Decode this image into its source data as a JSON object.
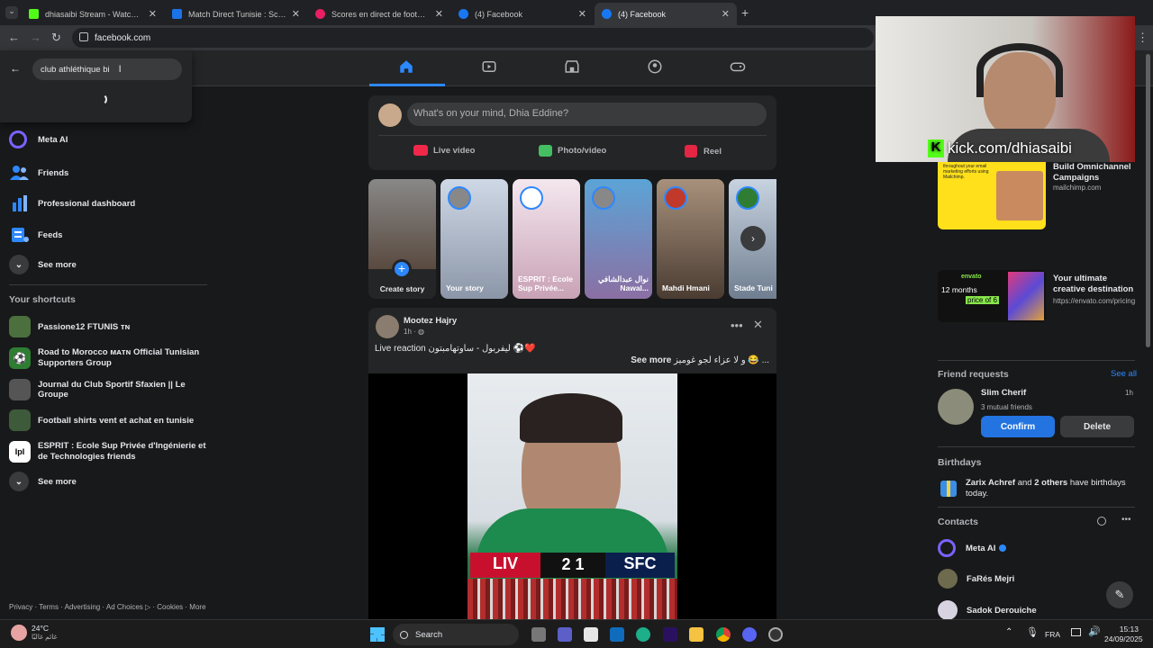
{
  "browser": {
    "tabs": [
      {
        "title": "dhiasaibi Stream - Watch Live o",
        "color": "#53fc18"
      },
      {
        "title": "Match Direct Tunisie : Scores et",
        "color": "#1a73e8"
      },
      {
        "title": "Scores en direct de football, rés",
        "color": "#e91e63"
      },
      {
        "title": "(4) Facebook",
        "color": "#1877f2"
      },
      {
        "title": "(4) Facebook",
        "color": "#1877f2"
      }
    ],
    "url": "facebook.com"
  },
  "search": {
    "value": "club athléthique bi"
  },
  "menu": {
    "items": [
      {
        "label": "Meta AI",
        "icon": "meta-ai-icon"
      },
      {
        "label": "Friends",
        "icon": "friends-icon"
      },
      {
        "label": "Professional dashboard",
        "icon": "dashboard-icon"
      },
      {
        "label": "Feeds",
        "icon": "feeds-icon"
      },
      {
        "label": "See more",
        "icon": "chevron-down-icon"
      }
    ],
    "shortcuts_title": "Your shortcuts",
    "shortcuts": [
      "Passione12 FTUNIS ᴛɴ",
      "Road to Morocco ᴍᴀᴛɴ Official Tunisian Supporters Group",
      "Journal du Club Sportif Sfaxien || Le Groupe",
      "Football shirts vent et achat en tunisie",
      "ESPRIT : Ecole Sup Privée d'Ingénierie et de Technologies friends"
    ],
    "shortcuts_more": "See more",
    "footer": "Privacy · Terms · Advertising · Ad Choices ▷ · Cookies · More"
  },
  "composer": {
    "placeholder": "What's on your mind, Dhia Eddine?",
    "live": "Live video",
    "photo": "Photo/video",
    "reel": "Reel"
  },
  "stories": [
    {
      "label": "Create story"
    },
    {
      "label": "Your story"
    },
    {
      "label": "ESPRIT : Ecole Sup Privée..."
    },
    {
      "label": "نوال عبدالشافي Nawal..."
    },
    {
      "label": "Mahdi Hmani"
    },
    {
      "label": "Stade Tunisi الملعب التونسي"
    }
  ],
  "post": {
    "author": "Mootez Hajry",
    "time": "1h · ",
    "line1": "Live reaction ليفربول - ساوتهامبتون ⚽❤️",
    "line2": "و لا عزاء لجو غوميز 😂 ...",
    "see_more": "See more",
    "score": {
      "home": "LIV",
      "away": "SFC",
      "home_goals": "2",
      "away_goals": "1"
    }
  },
  "stream": {
    "overlay": "kick.com/dhiasaibi"
  },
  "ads": [
    {
      "title": "Build Omnichannel Campaigns",
      "domain": "mailchimp.com",
      "snippet": "throughout your email marketing efforts using Mailchimp."
    },
    {
      "title": "Your ultimate creative destination",
      "domain": "https://envato.com/pricing",
      "badge1": "12 months",
      "badge2": "price of 6",
      "brand": "envato"
    }
  ],
  "friend_requests": {
    "title": "Friend requests",
    "see_all": "See all",
    "name": "Slim Cherif",
    "mutual": "3 mutual friends",
    "time": "1h",
    "confirm": "Confirm",
    "delete": "Delete"
  },
  "birthdays": {
    "title": "Birthdays",
    "name": "Zarix Achref",
    "rest": " and ",
    "others": "2 others",
    "tail": " have birthdays today."
  },
  "contacts": {
    "title": "Contacts",
    "list": [
      "Meta AI",
      "FaRés Mejri",
      "Sadok Derouiche"
    ]
  },
  "taskbar": {
    "weather_temp": "24°C",
    "weather_desc": "غائم غالبًا",
    "search": "Search",
    "lang": "FRA",
    "time": "15:13",
    "date": "24/09/2025"
  },
  "colors": {
    "accent": "#2d88ff",
    "bg": "#18191a",
    "card": "#242526"
  }
}
